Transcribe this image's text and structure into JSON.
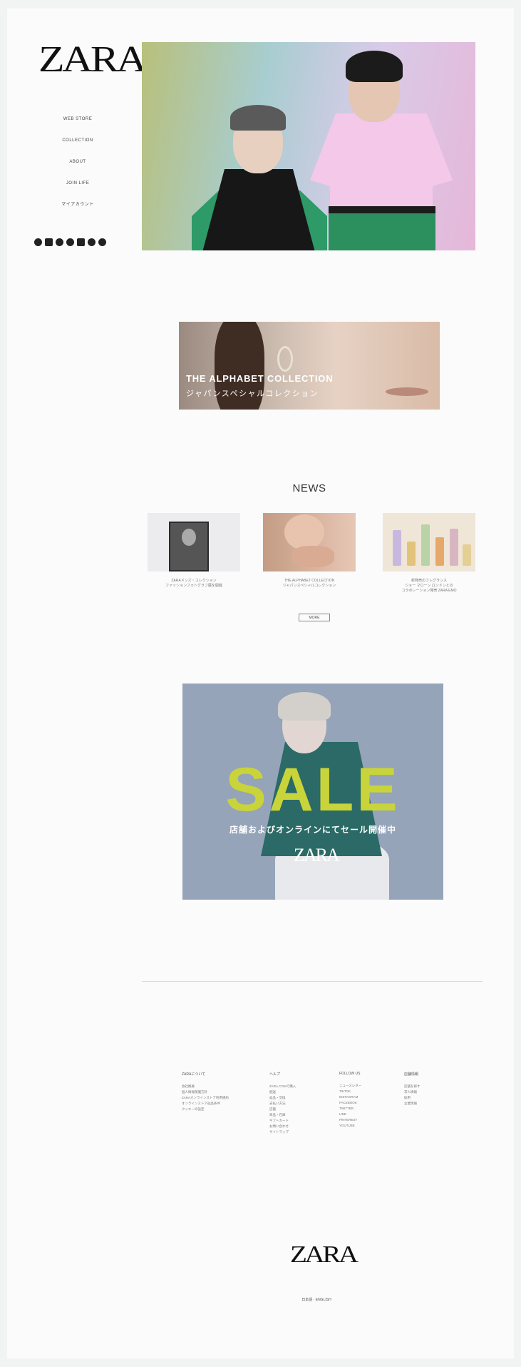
{
  "brand": {
    "logo_text": "ZARA"
  },
  "sidebar": {
    "nav": [
      {
        "label": "WEB STORE"
      },
      {
        "label": "COLLECTION"
      },
      {
        "label": "ABOUT"
      },
      {
        "label": "JOIN LIFE"
      },
      {
        "label": "マイアカウント"
      }
    ],
    "social": [
      "tiktok-icon",
      "instagram-icon",
      "facebook-icon",
      "twitter-icon",
      "youtube-icon",
      "pinterest-icon",
      "line-icon"
    ]
  },
  "collection_banner": {
    "title": "THE ALPHABET COLLECTION",
    "subtitle": "ジャパンスペシャルコレクション"
  },
  "news": {
    "heading": "NEWS",
    "items": [
      {
        "caption_line1": "ZARAメンズ・コレクション",
        "caption_line2": "ファッションフォトグラフ展を開催"
      },
      {
        "caption_line1": "THE ALPHABET COLLECTION",
        "caption_line2": "ジャパンスペシャルコレクション"
      },
      {
        "caption_line1": "新発売のフレグランス",
        "caption_line2": "ジョー マローン ロンドンとの",
        "caption_line3": "コラボレーション発売 ZARA EMO"
      }
    ],
    "more_label": "MORE"
  },
  "sale": {
    "title": "SALE",
    "subtitle": "店舗およびオンラインにてセール開催中",
    "logo_text": "ZARA"
  },
  "footer": {
    "columns": [
      {
        "heading": "ZARAについて",
        "items": [
          "会社概要",
          "個人情報保護方針",
          "ZARAオンラインストア利用規約",
          "オンラインストア返品条件",
          "クッキーの設定"
        ]
      },
      {
        "heading": "ヘルプ",
        "items": [
          "ZARA.COMで購入",
          "配送",
          "返品・交換",
          "支払い方法",
          "店舗",
          "商品・在庫",
          "ギフトカード",
          "お問い合わせ",
          "サイトマップ"
        ]
      },
      {
        "heading": "FOLLOW US",
        "items": [
          "ニュースレター",
          "TIKTOK",
          "INSTAGRAM",
          "FACEBOOK",
          "TWITTER",
          "LINE",
          "PINTEREST",
          "YOUTUBE"
        ]
      },
      {
        "heading": "店舗情報",
        "items": [
          "店舗を探す",
          "求人情報",
          "採用",
          "企業情報"
        ]
      }
    ],
    "logo_text": "ZARA",
    "language": "日本語 · ENGLISH"
  },
  "colors": {
    "sale_yellow": "#c8d43a",
    "sale_bg": "#95a4b9",
    "page_bg": "#fbfbfb"
  }
}
